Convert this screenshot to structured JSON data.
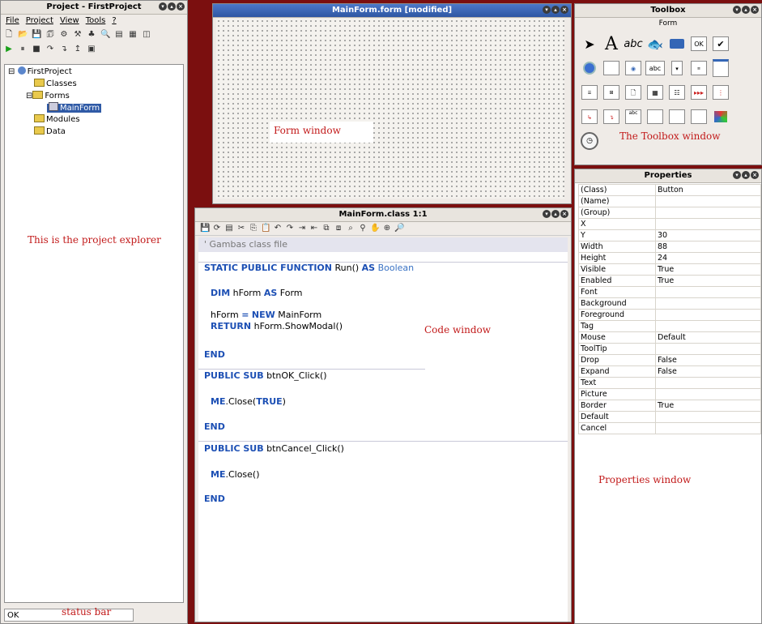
{
  "project": {
    "title": "Project - FirstProject",
    "menu": [
      "File",
      "Project",
      "View",
      "Tools",
      "?"
    ],
    "tree": {
      "root": "FirstProject",
      "classes": "Classes",
      "forms": "Forms",
      "mainform": "MainForm",
      "modules": "Modules",
      "data": "Data"
    },
    "status_text": "OK"
  },
  "form": {
    "title": "MainForm.form [modified]"
  },
  "code": {
    "title": "MainForm.class 1:1",
    "comment": "' Gambas class file",
    "l1_kw": "STATIC PUBLIC FUNCTION",
    "l1_rest": " Run() ",
    "l1_as": "AS",
    "l1_type": " Boolean",
    "l2_kw": "DIM",
    "l2_mid": " hForm ",
    "l2_as": "AS",
    "l2_type": " Form",
    "l3_a": "hForm ",
    "l3_eq": "=",
    "l3_new": "NEW",
    "l3_rest": " MainForm",
    "l4_kw": "RETURN",
    "l4_rest": " hForm.ShowModal()",
    "end": "END",
    "l5_kw": "PUBLIC SUB",
    "l5_rest": " btnOK_Click()",
    "l6_me": "ME",
    "l6_a": ".Close(",
    "l6_true": "TRUE",
    "l6_b": ")",
    "l7_kw": "PUBLIC SUB",
    "l7_rest": " btnCancel_Click()",
    "l8_me": "ME",
    "l8_rest": ".Close()"
  },
  "toolbox": {
    "title": "Toolbox",
    "subtitle": "Form",
    "text_label": "A",
    "abc_label": "abc",
    "ok_label": "OK",
    "check_label": "✔",
    "abc2_label": "abc"
  },
  "properties": {
    "title": "Properties",
    "rows": [
      {
        "k": "(Class)",
        "v": "Button"
      },
      {
        "k": "(Name)",
        "v": ""
      },
      {
        "k": "(Group)",
        "v": ""
      },
      {
        "k": "X",
        "v": ""
      },
      {
        "k": "Y",
        "v": "30"
      },
      {
        "k": "Width",
        "v": "88"
      },
      {
        "k": "Height",
        "v": "24"
      },
      {
        "k": "Visible",
        "v": "True"
      },
      {
        "k": "Enabled",
        "v": "True"
      },
      {
        "k": "Font",
        "v": ""
      },
      {
        "k": "Background",
        "v": ""
      },
      {
        "k": "Foreground",
        "v": ""
      },
      {
        "k": "Tag",
        "v": ""
      },
      {
        "k": "Mouse",
        "v": "Default"
      },
      {
        "k": "ToolTip",
        "v": ""
      },
      {
        "k": "Drop",
        "v": "False"
      },
      {
        "k": "Expand",
        "v": "False"
      },
      {
        "k": "Text",
        "v": ""
      },
      {
        "k": "Picture",
        "v": ""
      },
      {
        "k": "Border",
        "v": "True"
      },
      {
        "k": "Default",
        "v": ""
      },
      {
        "k": "Cancel",
        "v": ""
      }
    ]
  },
  "annotations": {
    "project_explorer": "This is the project explorer",
    "form_window": "Form window",
    "code_window": "Code window",
    "toolbox_window": "The Toolbox window",
    "properties_window": "Properties window",
    "status_bar": "status bar"
  }
}
